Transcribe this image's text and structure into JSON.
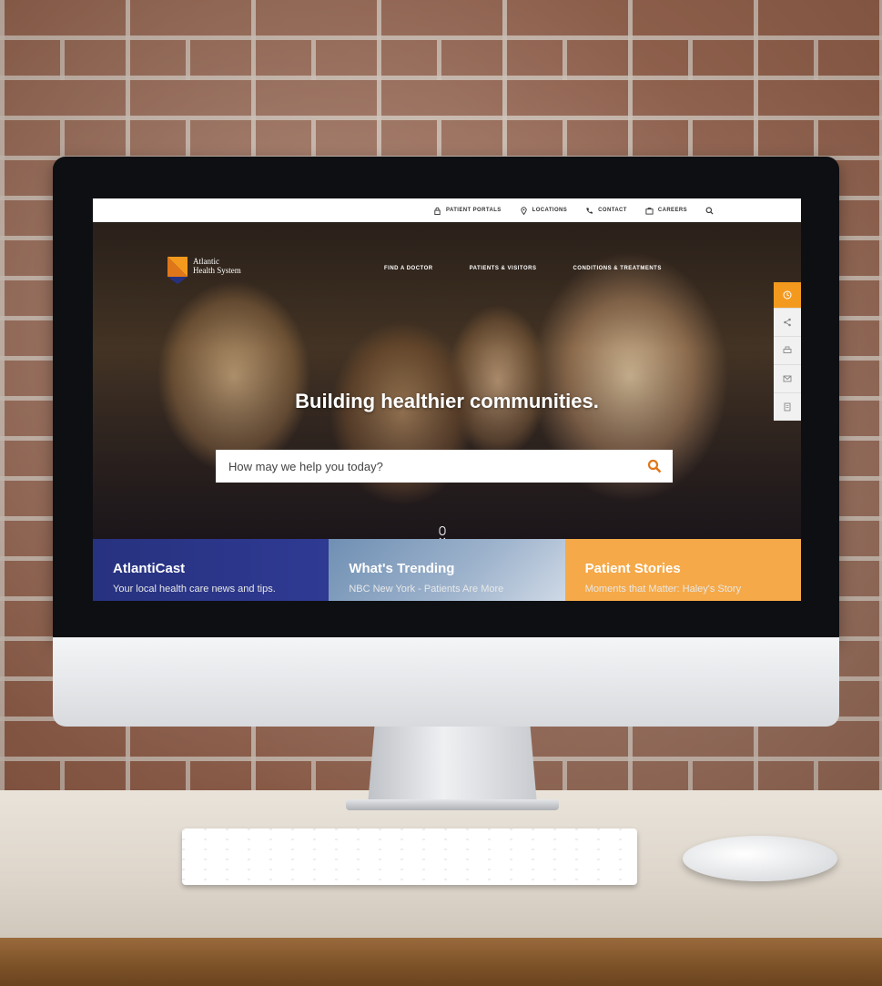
{
  "brand": {
    "name_line1": "Atlantic",
    "name_line2": "Health System",
    "colors": {
      "orange": "#f39a1e",
      "navy": "#27327f",
      "gold": "#f5a948"
    }
  },
  "utility_nav": [
    {
      "label": "PATIENT PORTALS",
      "icon": "lock-icon"
    },
    {
      "label": "LOCATIONS",
      "icon": "location-pin-icon"
    },
    {
      "label": "CONTACT",
      "icon": "phone-icon"
    },
    {
      "label": "CAREERS",
      "icon": "briefcase-icon"
    }
  ],
  "main_nav": [
    {
      "label": "FIND A DOCTOR"
    },
    {
      "label": "PATIENTS & VISITORS"
    },
    {
      "label": "CONDITIONS & TREATMENTS"
    }
  ],
  "hero": {
    "headline": "Building healthier communities.",
    "search_placeholder": "How may we help you today?"
  },
  "tiles": [
    {
      "title": "AtlantiCast",
      "subtitle": "Your local health care news and tips."
    },
    {
      "title": "What's Trending",
      "subtitle": "NBC New York - Patients Are More"
    },
    {
      "title": "Patient Stories",
      "subtitle": "Moments that Matter: Haley's Story"
    }
  ]
}
